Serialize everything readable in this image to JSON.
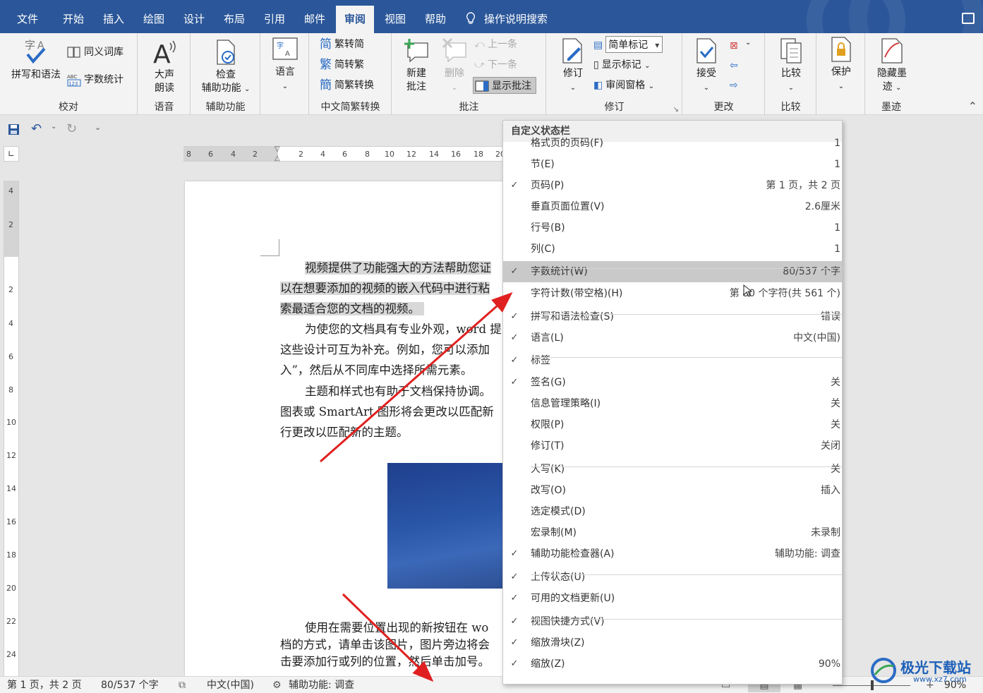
{
  "tabs": [
    "文件",
    "开始",
    "插入",
    "绘图",
    "设计",
    "布局",
    "引用",
    "邮件",
    "审阅",
    "视图",
    "帮助"
  ],
  "active_tab": "审阅",
  "tell_me": "操作说明搜索",
  "ribbon": {
    "proofing": {
      "spell": "拼写和语法",
      "thesaurus": "同义词库",
      "wordcount": "字数统计",
      "label": "校对"
    },
    "speech": {
      "read_aloud_1": "大声",
      "read_aloud_2": "朗读",
      "label": "语音"
    },
    "accessibility": {
      "check_1": "检查",
      "check_2": "辅助功能",
      "label": "辅助功能"
    },
    "language": {
      "btn": "语言",
      "label": ""
    },
    "chinese": {
      "t2s": "繁转简",
      "s2t": "简转繁",
      "convert": "简繁转换",
      "label": "中文简繁转换"
    },
    "comments": {
      "new_1": "新建",
      "new_2": "批注",
      "delete": "删除",
      "prev": "上一条",
      "next": "下一条",
      "show": "显示批注",
      "label": "批注"
    },
    "tracking": {
      "track": "修订",
      "markup_select": "简单标记",
      "show_markup": "显示标记",
      "pane": "审阅窗格",
      "label": "修订"
    },
    "changes": {
      "accept": "接受",
      "label": "更改"
    },
    "compare": {
      "btn": "比较",
      "label": "比较"
    },
    "protect": {
      "btn": "保护",
      "label": ""
    },
    "ink": {
      "btn_1": "隐藏墨",
      "btn_2": "迹",
      "label": "墨迹"
    }
  },
  "ruler_h": [
    "8",
    "6",
    "4",
    "2",
    "2",
    "4",
    "6",
    "8",
    "10",
    "12",
    "14",
    "16",
    "18",
    "20"
  ],
  "ruler_v": [
    "4",
    "2",
    "2",
    "4",
    "6",
    "8",
    "10",
    "12",
    "14",
    "16",
    "18",
    "20",
    "22",
    "24"
  ],
  "document": {
    "p1": [
      "视频提供了功能强大的方法帮助您证",
      "以在想要添加的视频的嵌入代码中进行粘",
      "索最适合您的文档的视频。"
    ],
    "p2": [
      "为使您的文档具有专业外观，word 提",
      "这些设计可互为补充。例如，您可以添加",
      "入”，然后从不同库中选择所需元素。"
    ],
    "p3": [
      "主题和样式也有助于文档保持协调。",
      "图表或 SmartArt 图形将会更改以匹配新",
      "行更改以匹配新的主题。"
    ],
    "p4": [
      "使用在需要位置出现的新按钮在 wo",
      "档的方式，请单击该图片，图片旁边将会",
      "击要添加行或列的位置，然后单击加号。"
    ]
  },
  "context_menu": {
    "title": "自定义状态栏",
    "items": [
      {
        "check": "",
        "label": "格式页的页码(F)",
        "value": "1"
      },
      {
        "check": "",
        "label": "节(E)",
        "value": "1"
      },
      {
        "check": "✓",
        "label": "页码(P)",
        "value": "第 1 页，共 2 页"
      },
      {
        "check": "",
        "label": "垂直页面位置(V)",
        "value": "2.6厘米"
      },
      {
        "check": "",
        "label": "行号(B)",
        "value": "1"
      },
      {
        "check": "",
        "label": "列(C)",
        "value": "1"
      },
      {
        "check": "✓",
        "label": "字数统计(W)",
        "value": "80/537 个字"
      },
      {
        "check": "",
        "label": "字符计数(带空格)(H)",
        "value": "第 80 个字符(共 561 个)"
      },
      {
        "check": "✓",
        "label": "拼写和语法检查(S)",
        "value": "错误"
      },
      {
        "check": "✓",
        "label": "语言(L)",
        "value": "中文(中国)"
      },
      {
        "check": "✓",
        "label": "标签",
        "value": ""
      },
      {
        "check": "✓",
        "label": "签名(G)",
        "value": "关"
      },
      {
        "check": "",
        "label": "信息管理策略(I)",
        "value": "关"
      },
      {
        "check": "",
        "label": "权限(P)",
        "value": "关"
      },
      {
        "check": "",
        "label": "修订(T)",
        "value": "关闭"
      },
      {
        "check": "",
        "label": "大写(K)",
        "value": "关"
      },
      {
        "check": "",
        "label": "改写(O)",
        "value": "插入"
      },
      {
        "check": "",
        "label": "选定模式(D)",
        "value": ""
      },
      {
        "check": "",
        "label": "宏录制(M)",
        "value": "未录制"
      },
      {
        "check": "✓",
        "label": "辅助功能检查器(A)",
        "value": "辅助功能: 调查"
      },
      {
        "check": "✓",
        "label": "上传状态(U)",
        "value": ""
      },
      {
        "check": "✓",
        "label": "可用的文档更新(U)",
        "value": ""
      },
      {
        "check": "✓",
        "label": "视图快捷方式(V)",
        "value": ""
      },
      {
        "check": "✓",
        "label": "缩放滑块(Z)",
        "value": ""
      },
      {
        "check": "✓",
        "label": "缩放(Z)",
        "value": "90%"
      }
    ]
  },
  "status": {
    "page": "第 1 页，共 2 页",
    "words": "80/537 个字",
    "language": "中文(中国)",
    "accessibility": "辅助功能: 调查",
    "zoom": "90%"
  },
  "watermark": {
    "text": "极光下载站",
    "url": "www.xz7.com"
  },
  "colors": {
    "brand": "#2b579a",
    "arrow": "#e02020"
  }
}
